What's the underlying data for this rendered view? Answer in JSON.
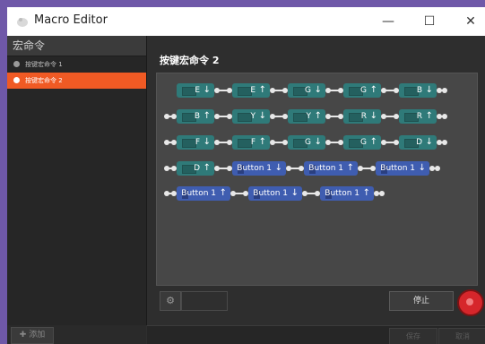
{
  "window": {
    "title": "Macro Editor",
    "controls": {
      "minimize": "—",
      "maximize": "☐",
      "close": "✕"
    }
  },
  "sidebar": {
    "header": "宏命令",
    "items": [
      {
        "label": "按键宏命令 1",
        "active": false
      },
      {
        "label": "按键宏命令 2",
        "active": true
      }
    ],
    "add_button": "添加"
  },
  "editor": {
    "title": "按键宏命令 2",
    "rows": [
      [
        {
          "type": "key",
          "label": "E",
          "dir": "↓"
        },
        {
          "type": "key",
          "label": "E",
          "dir": "↑"
        },
        {
          "type": "key",
          "label": "G",
          "dir": "↓"
        },
        {
          "type": "key",
          "label": "G",
          "dir": "↑"
        },
        {
          "type": "key",
          "label": "B",
          "dir": "↓"
        }
      ],
      [
        {
          "type": "key",
          "label": "B",
          "dir": "↑"
        },
        {
          "type": "key",
          "label": "Y",
          "dir": "↓"
        },
        {
          "type": "key",
          "label": "Y",
          "dir": "↑"
        },
        {
          "type": "key",
          "label": "R",
          "dir": "↓"
        },
        {
          "type": "key",
          "label": "R",
          "dir": "↑"
        }
      ],
      [
        {
          "type": "key",
          "label": "F",
          "dir": "↓"
        },
        {
          "type": "key",
          "label": "F",
          "dir": "↑"
        },
        {
          "type": "key",
          "label": "G",
          "dir": "↓"
        },
        {
          "type": "key",
          "label": "G",
          "dir": "↑"
        },
        {
          "type": "key",
          "label": "D",
          "dir": "↓"
        }
      ],
      [
        {
          "type": "key",
          "label": "D",
          "dir": "↑"
        },
        {
          "type": "mouse",
          "label": "Button 1",
          "dir": "↓"
        },
        {
          "type": "mouse",
          "label": "Button 1",
          "dir": "↑"
        },
        {
          "type": "mouse",
          "label": "Button 1",
          "dir": "↓"
        }
      ],
      [
        {
          "type": "mouse",
          "label": "Button 1",
          "dir": "↑"
        },
        {
          "type": "mouse",
          "label": "Button 1",
          "dir": "↓"
        },
        {
          "type": "mouse",
          "label": "Button 1",
          "dir": "↑"
        }
      ]
    ],
    "stop_label": "停止"
  },
  "footer": {
    "ok_label": "保存",
    "cancel_label": "取消"
  },
  "colors": {
    "accent": "#f05a24",
    "key_chip": "#2f7a79",
    "mouse_chip": "#3f5db0",
    "record": "#d6262b"
  }
}
